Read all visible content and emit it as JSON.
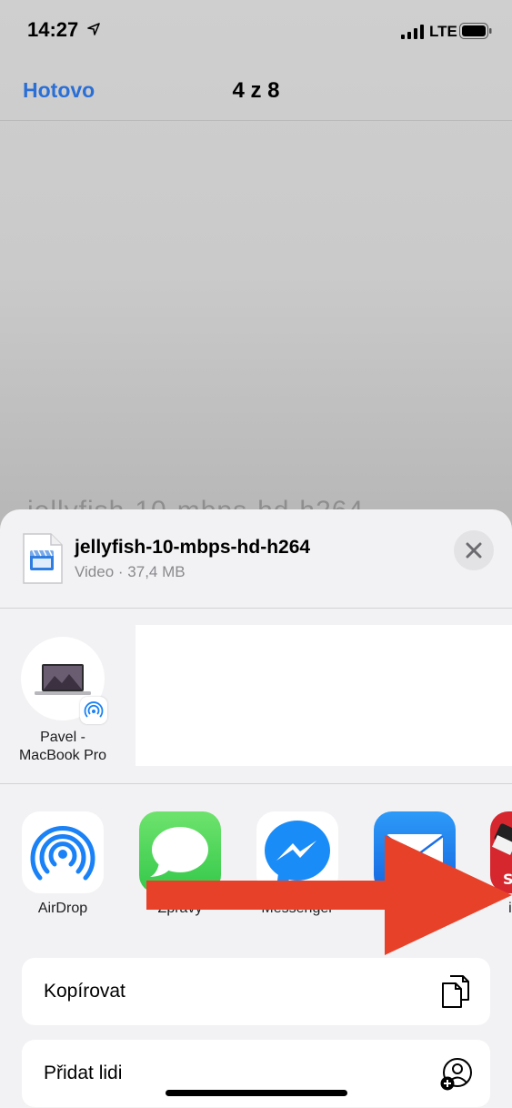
{
  "status_bar": {
    "time": "14:27",
    "network": "LTE"
  },
  "nav": {
    "done_label": "Hotovo",
    "counter": "4 z 8"
  },
  "background_title": "jellyfish-10-mbps-hd-h264",
  "share_sheet": {
    "file_name": "jellyfish-10-mbps-hd-h264",
    "file_meta": "Video · 37,4 MB",
    "person": {
      "name_line1": "Pavel -",
      "name_line2": "MacBook Pro"
    },
    "apps": [
      {
        "label": "AirDrop",
        "icon": "airdrop-icon"
      },
      {
        "label": "Zprávy",
        "icon": "messages-icon"
      },
      {
        "label": "Messenger",
        "icon": "messenger-icon"
      },
      {
        "label": "Mail",
        "icon": "mail-icon"
      },
      {
        "label": "iXpand",
        "icon": "ixpand-icon"
      }
    ],
    "actions": [
      {
        "label": "Kopírovat",
        "icon": "copy-icon"
      },
      {
        "label": "Přidat lidi",
        "icon": "add-people-icon"
      }
    ]
  },
  "colors": {
    "accent": "#2a6fd6",
    "arrow": "#e8412a",
    "messages_green": "#4cd964",
    "airdrop_blue": "#1a82f6"
  }
}
